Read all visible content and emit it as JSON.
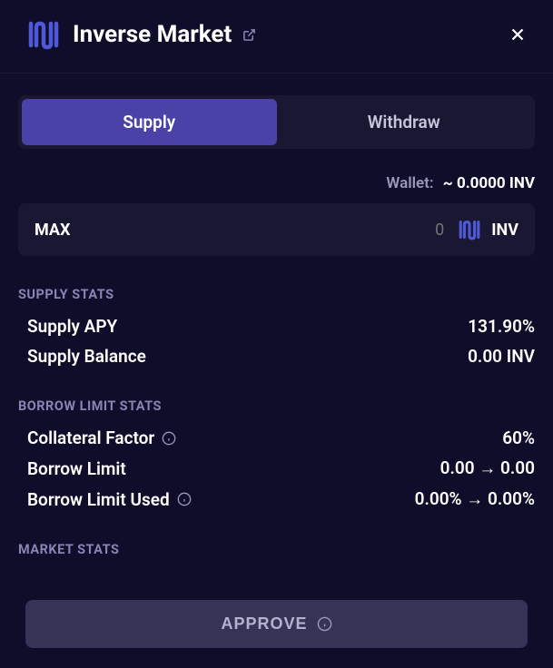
{
  "header": {
    "title": "Inverse Market"
  },
  "tabs": {
    "supply": "Supply",
    "withdraw": "Withdraw"
  },
  "wallet": {
    "label": "Wallet:",
    "value": "~ 0.0000 INV"
  },
  "input": {
    "max_label": "MAX",
    "placeholder": "0",
    "token_symbol": "INV"
  },
  "supply_stats": {
    "title": "SUPPLY STATS",
    "apy": {
      "label": "Supply APY",
      "value": "131.90%"
    },
    "balance": {
      "label": "Supply Balance",
      "value": "0.00 INV"
    }
  },
  "borrow_stats": {
    "title": "BORROW LIMIT STATS",
    "collateral": {
      "label": "Collateral Factor",
      "value": "60%"
    },
    "limit": {
      "label": "Borrow Limit",
      "value": "0.00 → 0.00"
    },
    "used": {
      "label": "Borrow Limit Used",
      "value": "0.00% → 0.00%"
    }
  },
  "market_stats": {
    "title": "MARKET STATS"
  },
  "footer": {
    "approve_label": "APPROVE"
  }
}
